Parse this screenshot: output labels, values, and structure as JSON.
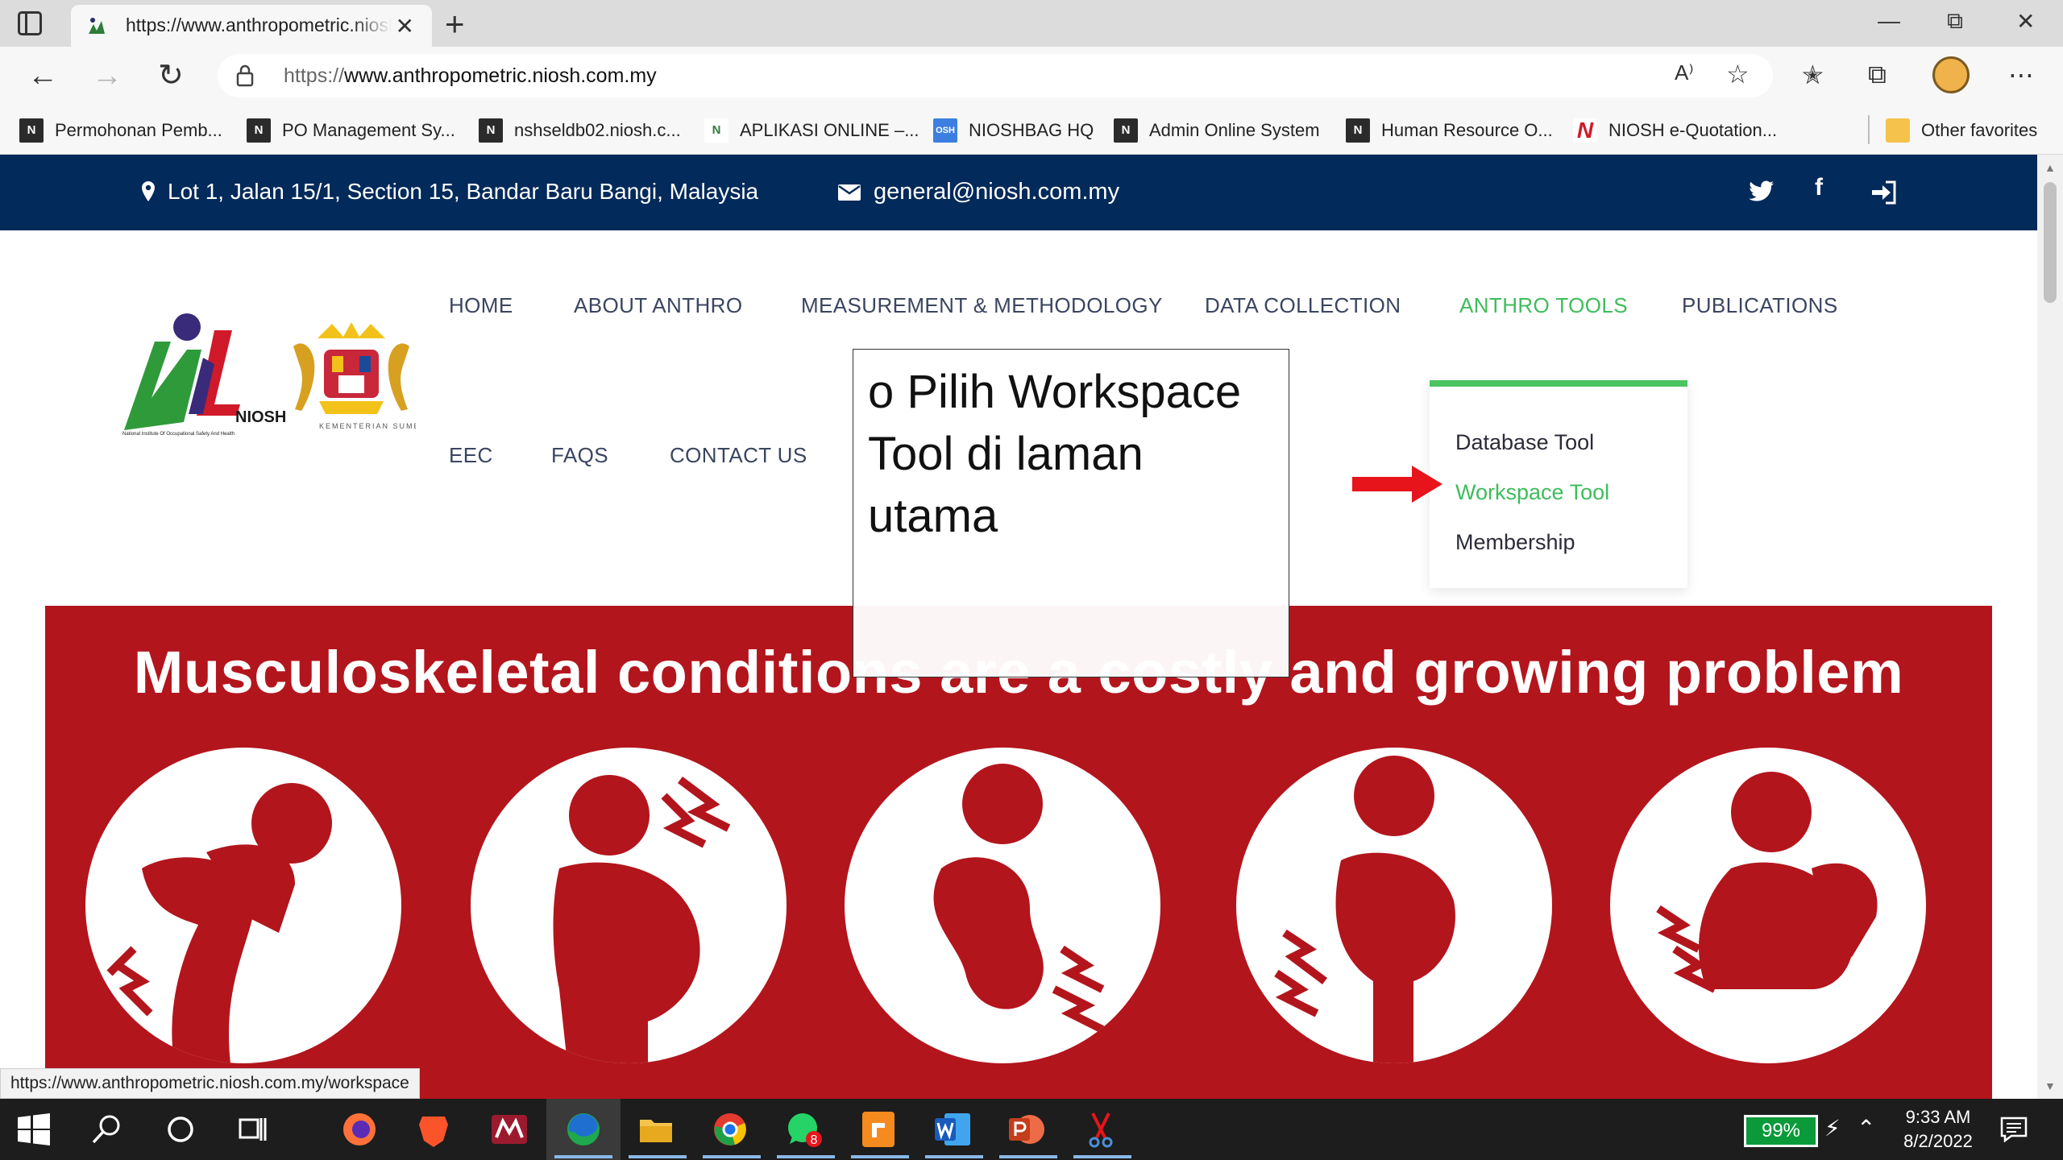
{
  "browser": {
    "tab_title": "https://www.anthropometric.niosh.com.my",
    "tab_close": "✕",
    "new_tab": "+",
    "url_protocol": "https://",
    "url_rest": "www.anthropometric.niosh.com.my",
    "bookmarks": [
      {
        "label": "Permohonan Pemb...",
        "icon": "niosh-icon"
      },
      {
        "label": "PO Management Sy...",
        "icon": "niosh-icon"
      },
      {
        "label": "nshseldb02.niosh.c...",
        "icon": "niosh-icon"
      },
      {
        "label": "APLIKASI ONLINE –...",
        "icon": "niosh-icon"
      },
      {
        "label": "NIOSHBAG HQ",
        "icon": "osh-icon"
      },
      {
        "label": "Admin Online System",
        "icon": "niosh-icon"
      },
      {
        "label": "Human Resource O...",
        "icon": "niosh-icon"
      },
      {
        "label": "NIOSH e-Quotation...",
        "icon": "n-red-icon"
      }
    ],
    "other_favorites": "Other favorites",
    "status_url": "https://www.anthropometric.niosh.com.my/workspace"
  },
  "topbar": {
    "address": "Lot 1, Jalan 15/1, Section 15, Bandar Baru Bangi, Malaysia",
    "email": "general@niosh.com.my",
    "bg_color": "#022a5a"
  },
  "logo": {
    "niosh_text": "NIOSH",
    "niosh_sub": "National Institute Of Occupational Safety And Health",
    "crest_text": "KEMENTERIAN SUMBER MANUSIA"
  },
  "nav": {
    "home": "HOME",
    "about": "ABOUT ANTHRO",
    "measurement": "MEASUREMENT & METHODOLOGY",
    "data_collection": "DATA COLLECTION",
    "anthro_tools": "ANTHRO TOOLS",
    "publications": "PUBLICATIONS",
    "eec": "EEC",
    "faqs": "FAQS",
    "contact": "CONTACT US",
    "active_color": "#3ebd5b"
  },
  "dropdown": {
    "items": [
      "Database Tool",
      "Workspace Tool",
      "Membership"
    ]
  },
  "annotation": {
    "text": "o Pilih Workspace Tool di laman utama",
    "arrow_color": "#e8141b"
  },
  "banner": {
    "headline": "Musculoskeletal conditions are a costly and growing problem",
    "bg_color": "#b3151d"
  },
  "taskbar": {
    "battery": "99%",
    "time": "9:33 AM",
    "date": "8/2/2022",
    "whatsapp_badge": "8"
  }
}
